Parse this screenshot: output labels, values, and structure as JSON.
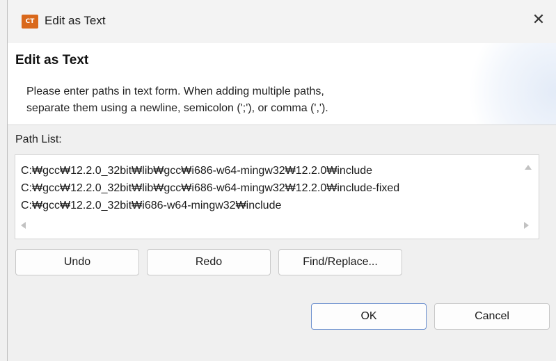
{
  "window": {
    "title": "Edit as Text",
    "app_icon_text": "CT"
  },
  "header": {
    "title": "Edit as Text",
    "description_line1": "Please enter paths in text form. When adding multiple paths,",
    "description_line2": "separate them using a newline, semicolon (';'), or comma (',')."
  },
  "path_list": {
    "label": "Path List:",
    "lines": [
      "C:₩gcc₩12.2.0_32bit₩lib₩gcc₩i686-w64-mingw32₩12.2.0₩include",
      "C:₩gcc₩12.2.0_32bit₩lib₩gcc₩i686-w64-mingw32₩12.2.0₩include-fixed",
      "C:₩gcc₩12.2.0_32bit₩i686-w64-mingw32₩include"
    ]
  },
  "actions": {
    "undo": "Undo",
    "redo": "Redo",
    "find_replace": "Find/Replace..."
  },
  "footer": {
    "ok": "OK",
    "cancel": "Cancel"
  },
  "icons": {
    "close": "close-icon",
    "app": "app-icon"
  },
  "colors": {
    "app_icon": "#d9681b",
    "primary_border": "#6b8fce"
  }
}
